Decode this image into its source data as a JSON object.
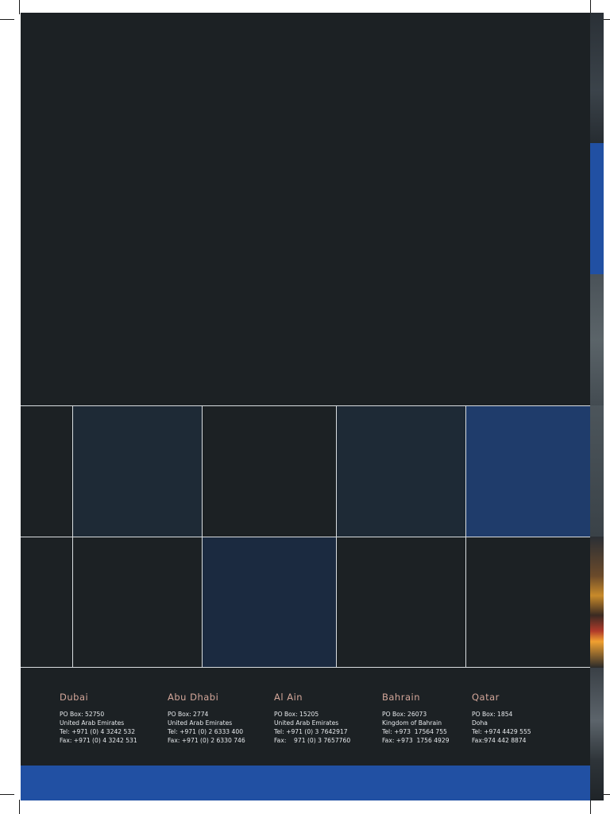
{
  "colors": {
    "background": "#1c2124",
    "cell_dark_blue": "#1e2a36",
    "cell_mid_blue": "#1b2a40",
    "cell_accent_blue": "#1f3c6b",
    "grid_lines": "#d9dde0",
    "office_name": "#d4a79a",
    "office_text": "#e6e9ec",
    "bottom_band": "#2150a3"
  },
  "offices": [
    {
      "name": "Dubai",
      "lines": [
        "PO Box: 52750",
        "United Arab Emirates",
        "Tel: +971 (0) 4 3242 532",
        "Fax: +971 (0) 4 3242 531"
      ]
    },
    {
      "name": "Abu Dhabi",
      "lines": [
        "PO Box: 2774",
        "United Arab Emirates",
        "Tel: +971 (0) 2 6333 400",
        "Fax: +971 (0) 2 6330 746"
      ]
    },
    {
      "name": "Al Ain",
      "lines": [
        "PO Box: 15205",
        "United Arab Emirates",
        "Tel: +971 (0) 3 7642917",
        "Fax:    971 (0) 3 7657760"
      ]
    },
    {
      "name": "Bahrain",
      "lines": [
        "PO Box: 26073",
        "Kingdom of Bahrain",
        "Tel: +973  17564 755",
        "Fax: +973  1756 4929"
      ]
    },
    {
      "name": "Qatar",
      "lines": [
        "PO Box: 1854",
        "Doha",
        "Tel: +974 4429 555",
        "Fax:974 442 8874"
      ]
    }
  ]
}
